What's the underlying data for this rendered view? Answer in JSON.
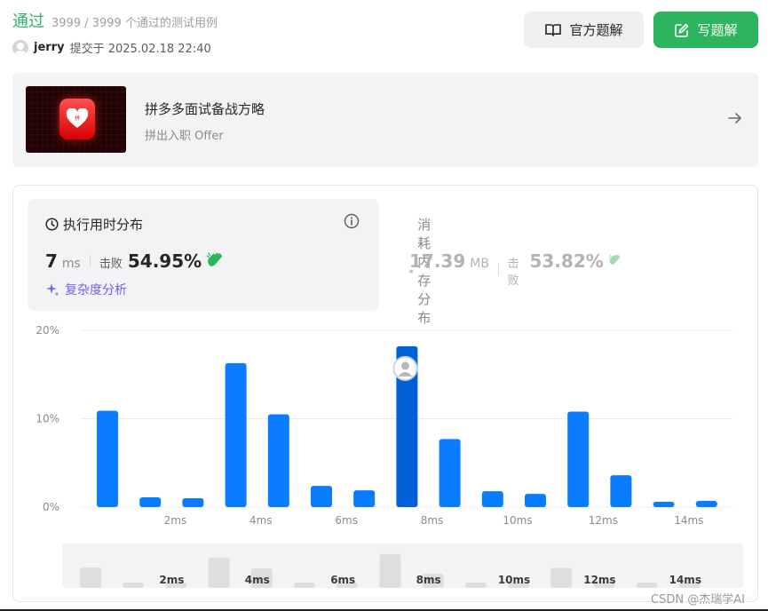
{
  "header": {
    "status": "通过",
    "cases": "3999 / 3999 个通过的测试用例",
    "user": "jerry",
    "submitted": "提交于 2025.02.18 22:40"
  },
  "buttons": {
    "official_solution": "官方题解",
    "write_solution": "写题解"
  },
  "promo": {
    "title": "拼多多面试备战方略",
    "subtitle": "拼出入职 Offer"
  },
  "runtime": {
    "title": "执行用时分布",
    "value": "7",
    "unit": "ms",
    "beat_label": "击败",
    "beat_value": "54.95%",
    "complexity_link": "复杂度分析"
  },
  "memory": {
    "title": "消耗内存分布",
    "value": "17.39",
    "unit": "MB",
    "beat_label": "击败",
    "beat_value": "53.82%"
  },
  "chart_data": {
    "type": "bar",
    "x": [
      1,
      2,
      3,
      4,
      5,
      6,
      7,
      8,
      9,
      10,
      11,
      12,
      13,
      14,
      15
    ],
    "values": [
      10.9,
      1.1,
      1.0,
      16.3,
      10.5,
      2.4,
      1.9,
      18.2,
      7.7,
      1.8,
      1.5,
      10.8,
      3.6,
      0.6,
      0.7
    ],
    "x_tick_labels": [
      "2ms",
      "4ms",
      "6ms",
      "8ms",
      "10ms",
      "12ms",
      "14ms"
    ],
    "x_tick_positions": [
      3,
      5,
      7,
      9,
      11,
      13,
      15
    ],
    "y_tick_labels": [
      "0%",
      "10%",
      "20%"
    ],
    "ylim": [
      0,
      20
    ],
    "highlight_x": 8,
    "bar_color": "#0a7cff",
    "highlight_color": "#0060d6",
    "grid": true
  },
  "watermark": "CSDN @杰瑞学AI"
}
